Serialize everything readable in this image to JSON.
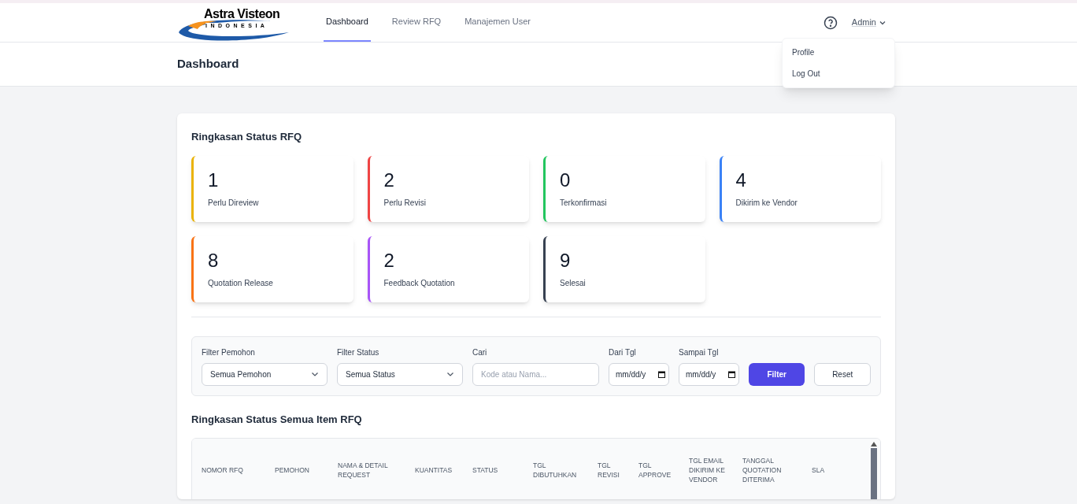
{
  "brand": {
    "name": "Astra Visteon",
    "subtitle": "INDONESIA"
  },
  "nav": [
    {
      "label": "Dashboard",
      "selected": true
    },
    {
      "label": "Review RFQ",
      "selected": false
    },
    {
      "label": "Manajemen User",
      "selected": false
    }
  ],
  "user_menu": {
    "label": "Admin",
    "expanded": true,
    "items": [
      "Profile",
      "Log Out"
    ]
  },
  "page_title": "Dashboard",
  "summary": {
    "title": "Ringkasan Status RFQ",
    "cards": [
      {
        "count": "1",
        "label": "Perlu Direview",
        "color": "#eab308"
      },
      {
        "count": "2",
        "label": "Perlu Revisi",
        "color": "#ef4444"
      },
      {
        "count": "0",
        "label": "Terkonfirmasi",
        "color": "#22c55e"
      },
      {
        "count": "4",
        "label": "Dikirim ke Vendor",
        "color": "#3b82f6"
      },
      {
        "count": "8",
        "label": "Quotation Release",
        "color": "#f97316"
      },
      {
        "count": "2",
        "label": "Feedback Quotation",
        "color": "#a855f7"
      },
      {
        "count": "9",
        "label": "Selesai",
        "color": "#374151"
      }
    ]
  },
  "filters": {
    "fields": [
      {
        "kind": "select",
        "label": "Filter Pemohon",
        "value": "Semua Pemohon"
      },
      {
        "kind": "select",
        "label": "Filter Status",
        "value": "Semua Status"
      },
      {
        "kind": "text",
        "label": "Cari",
        "placeholder": "Kode atau Nama..."
      },
      {
        "kind": "date",
        "label": "Dari Tgl",
        "value": "mm/dd/y"
      },
      {
        "kind": "date",
        "label": "Sampai Tgl",
        "value": "mm/dd/y"
      }
    ],
    "buttons": [
      {
        "label": "Filter",
        "primary": true
      },
      {
        "label": "Reset",
        "primary": false
      }
    ]
  },
  "table": {
    "title": "Ringkasan Status Semua Item RFQ",
    "columns": [
      "NOMOR RFQ",
      "PEMOHON",
      "NAMA & DETAIL REQUEST",
      "KUANTITAS",
      "STATUS",
      "TGL DIBUTUHKAN",
      "TGL REVISI",
      "TGL APPROVE",
      "TGL EMAIL DIKIRIM KE VENDOR",
      "TANGGAL QUOTATION DITERIMA",
      "SLA"
    ]
  }
}
